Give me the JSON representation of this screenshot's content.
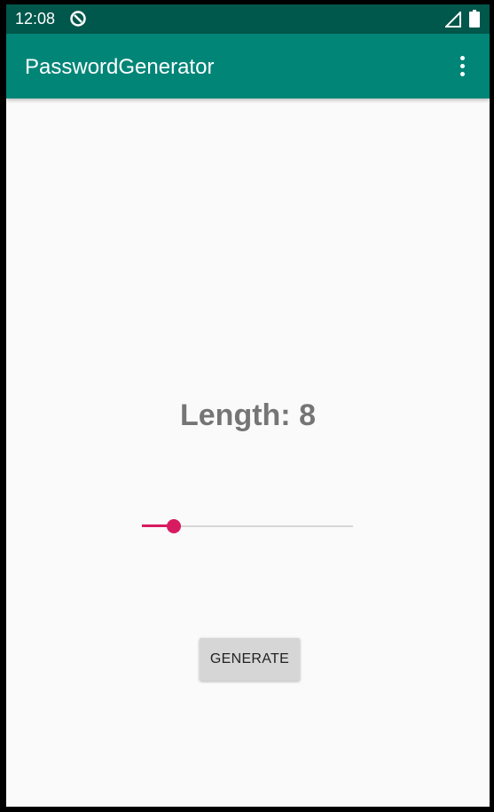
{
  "status_bar": {
    "time": "12:08",
    "notification_icon": "data-saver-icon",
    "signal_icon": "signal-icon",
    "battery_icon": "battery-icon"
  },
  "app_bar": {
    "title": "PasswordGenerator",
    "overflow_icon": "more-vert-icon"
  },
  "main": {
    "length_label": "Length: 8",
    "seekbar": {
      "value_fraction": 0.15
    },
    "generate_label": "GENERATE"
  },
  "colors": {
    "status_bar": "#00574b",
    "app_bar": "#008577",
    "accent": "#d81b60",
    "length_text": "#757575",
    "button_bg": "#d6d6d6"
  }
}
